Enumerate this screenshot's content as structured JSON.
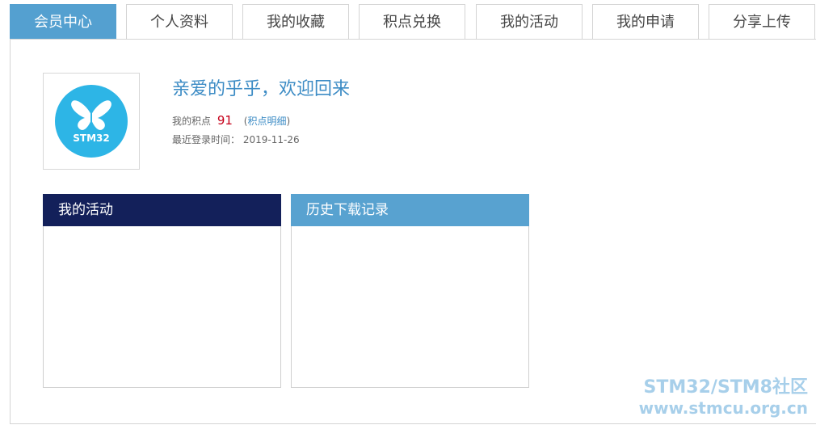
{
  "tabs": [
    {
      "label": "会员中心",
      "active": true
    },
    {
      "label": "个人资料",
      "active": false
    },
    {
      "label": "我的收藏",
      "active": false
    },
    {
      "label": "积点兑换",
      "active": false
    },
    {
      "label": "我的活动",
      "active": false
    },
    {
      "label": "我的申请",
      "active": false
    },
    {
      "label": "分享上传",
      "active": false
    }
  ],
  "avatar": {
    "logo_text": "STM32",
    "icon": "butterfly-logo"
  },
  "welcome": {
    "title": "亲爱的乎乎，欢迎回来",
    "points_label": "我的积点",
    "points_value": "91",
    "points_link_open": "(",
    "points_link": "积点明细",
    "points_link_close": ")",
    "last_login_label": "最近登录时间：",
    "last_login_value": "2019-11-26"
  },
  "panels": {
    "activity_title": "我的活动",
    "history_title": "历史下载记录"
  },
  "watermark": {
    "line1": "STM32/STM8社区",
    "line2": "www.stmcu.org.cn"
  },
  "colors": {
    "active_tab": "#54a0d0",
    "title_blue": "#3d8cc5",
    "points_red": "#c6001a",
    "activity_header": "#13205a",
    "history_header": "#58a2d0"
  }
}
